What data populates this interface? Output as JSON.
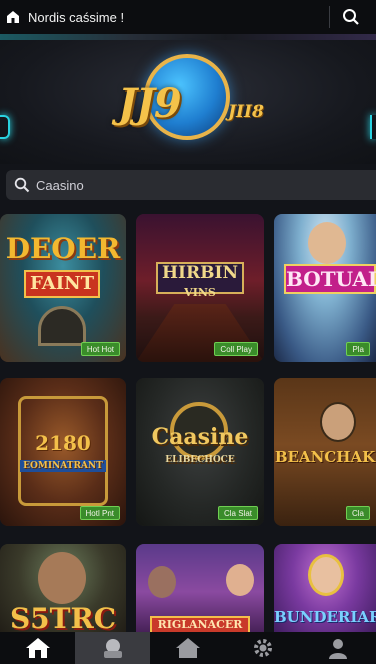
{
  "topbar": {
    "title": "Nordis caśsime !"
  },
  "hero": {
    "logo_main": "JJ9",
    "logo_sub": "JII8"
  },
  "search": {
    "placeholder": "Caasino"
  },
  "games": [
    {
      "title": "DEOER\nFAINT",
      "badge": "Hot Hot"
    },
    {
      "title": "HIRBIN\nVINS",
      "badge": "Coll Play"
    },
    {
      "title": "BOTUAL",
      "badge": "Pla"
    },
    {
      "title": "2180\nEOMINATRANT",
      "badge": "Hotl Pnt"
    },
    {
      "title": "Caasine\nELIBECHOCE",
      "badge": "Cla Slat"
    },
    {
      "title": "BEANCHAK",
      "badge": "Cla"
    },
    {
      "title": "S5TRC",
      "badge": ""
    },
    {
      "title": "RIGLANACER",
      "badge": ""
    },
    {
      "title": "BUNDERIAR",
      "badge": ""
    }
  ],
  "nav": [
    {
      "icon": "home-icon"
    },
    {
      "icon": "slot-icon"
    },
    {
      "icon": "house-icon"
    },
    {
      "icon": "gear-icon"
    },
    {
      "icon": "profile-icon"
    }
  ],
  "colors": {
    "accent": "#f4c24a",
    "badge": "#3a8c2a",
    "bg": "#121419"
  }
}
